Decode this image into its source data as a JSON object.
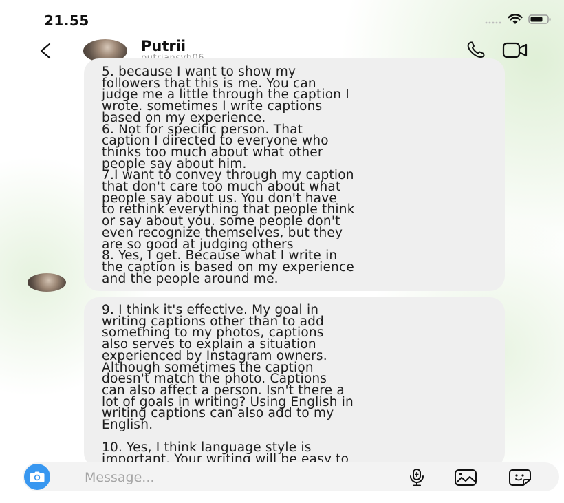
{
  "status_bar": {
    "time": "21.55",
    "signal_icon": "cellular-signal-icon",
    "wifi_icon": "wifi-icon",
    "battery_icon": "battery-icon"
  },
  "header": {
    "back_icon": "chevron-left-icon",
    "contact_name": "Putrii",
    "contact_username": "putriansyh06",
    "call_icon": "phone-icon",
    "video_icon": "video-camera-icon"
  },
  "messages": [
    {
      "text": "5. because I want to show my\nfollowers that this is me. You can\njudge me a little through the caption I\nwrote. sometimes I write captions\nbased on my experience.\n6. Not for specific person. That\ncaption I directed to everyone who\nthinks too much about what other\npeople say about him.\n7.I want to convey through my caption\nthat don't care too much about what\npeople say about us. You don't have\nto rethink everything that people think\nor say about you. some people don't\neven recognize themselves, but they\nare so good at judging others\n8. Yes, I get. Because what I write in\nthe caption is based on my experience\nand the people around me."
    },
    {
      "text": "9. I think it's effective. My goal in\nwriting captions other than to add\nsomething to my photos, captions\nalso serves to explain a situation\nexperienced by Instagram owners.\nAlthough sometimes the caption\ndoesn't match the photo. Captions\ncan also affect a person. Isn't there a\nlot of goals in writing? Using English in\nwriting captions can also add to my\nEnglish.\n\n10. Yes, I think language style is\nimportant. Your writing will be easy to"
    }
  ],
  "composer": {
    "camera_icon": "camera-icon",
    "placeholder": "Message...",
    "value": "",
    "mic_icon": "microphone-icon",
    "gallery_icon": "image-icon",
    "sticker_icon": "sticker-icon"
  },
  "colors": {
    "accent": "#3897f0",
    "bubble": "#efefef",
    "muted_text": "#9a9a9a"
  }
}
